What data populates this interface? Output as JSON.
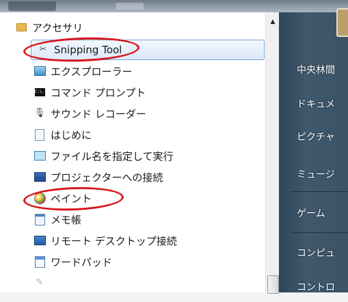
{
  "program_list": {
    "folder": {
      "label": "アクセサリ",
      "icon": "folder-icon"
    },
    "items": [
      {
        "label": "Snipping Tool",
        "icon": "scissors-icon",
        "selected": true,
        "circled": true
      },
      {
        "label": "エクスプローラー",
        "icon": "explorer-icon"
      },
      {
        "label": "コマンド プロンプト",
        "icon": "cmd-icon",
        "icon_text": "C:\\."
      },
      {
        "label": "サウンド レコーダー",
        "icon": "microphone-icon"
      },
      {
        "label": "はじめに",
        "icon": "document-icon"
      },
      {
        "label": "ファイル名を指定して実行",
        "icon": "run-icon"
      },
      {
        "label": "プロジェクターへの接続",
        "icon": "projector-icon"
      },
      {
        "label": "ペイント",
        "icon": "paint-icon",
        "circled": true
      },
      {
        "label": "メモ帳",
        "icon": "notepad-icon"
      },
      {
        "label": "リモート デスクトップ接続",
        "icon": "remote-desktop-icon"
      },
      {
        "label": "ワードパッド",
        "icon": "wordpad-icon"
      }
    ]
  },
  "scrollbar": {
    "up_arrow": "▲"
  },
  "right_pane": {
    "items": [
      "中央林間",
      "ドキュメ",
      "ピクチャ",
      "ミュージ",
      "ゲーム",
      "コンピュ",
      "コントロ"
    ]
  },
  "colors": {
    "annotation_red": "#d8161c",
    "selection_border": "#7da2ce",
    "right_pane_bg": "#3a5366"
  }
}
